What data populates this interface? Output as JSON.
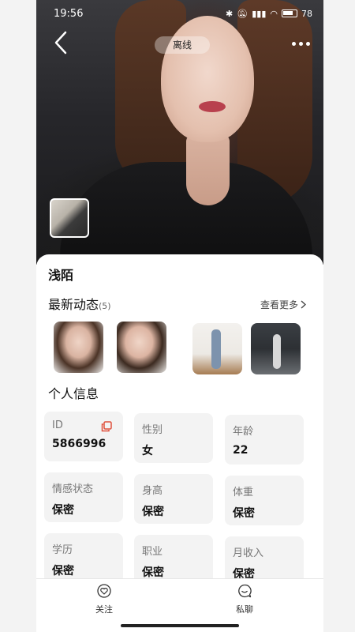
{
  "status_bar": {
    "time": "19:56",
    "battery": "78"
  },
  "profile": {
    "online_status": "离线",
    "name": "浅陌"
  },
  "moments": {
    "title": "最新动态",
    "count": "(5)",
    "see_more": "查看更多"
  },
  "personal_info": {
    "title": "个人信息",
    "fields": [
      {
        "label": "ID",
        "value": "5866996"
      },
      {
        "label": "性别",
        "value": "女"
      },
      {
        "label": "年龄",
        "value": "22"
      },
      {
        "label": "情感状态",
        "value": "保密"
      },
      {
        "label": "身高",
        "value": "保密"
      },
      {
        "label": "体重",
        "value": "保密"
      },
      {
        "label": "学历",
        "value": "保密"
      },
      {
        "label": "职业",
        "value": "保密"
      },
      {
        "label": "月收入",
        "value": "保密"
      }
    ]
  },
  "bottom_bar": {
    "follow_label": "关注",
    "chat_label": "私聊"
  }
}
